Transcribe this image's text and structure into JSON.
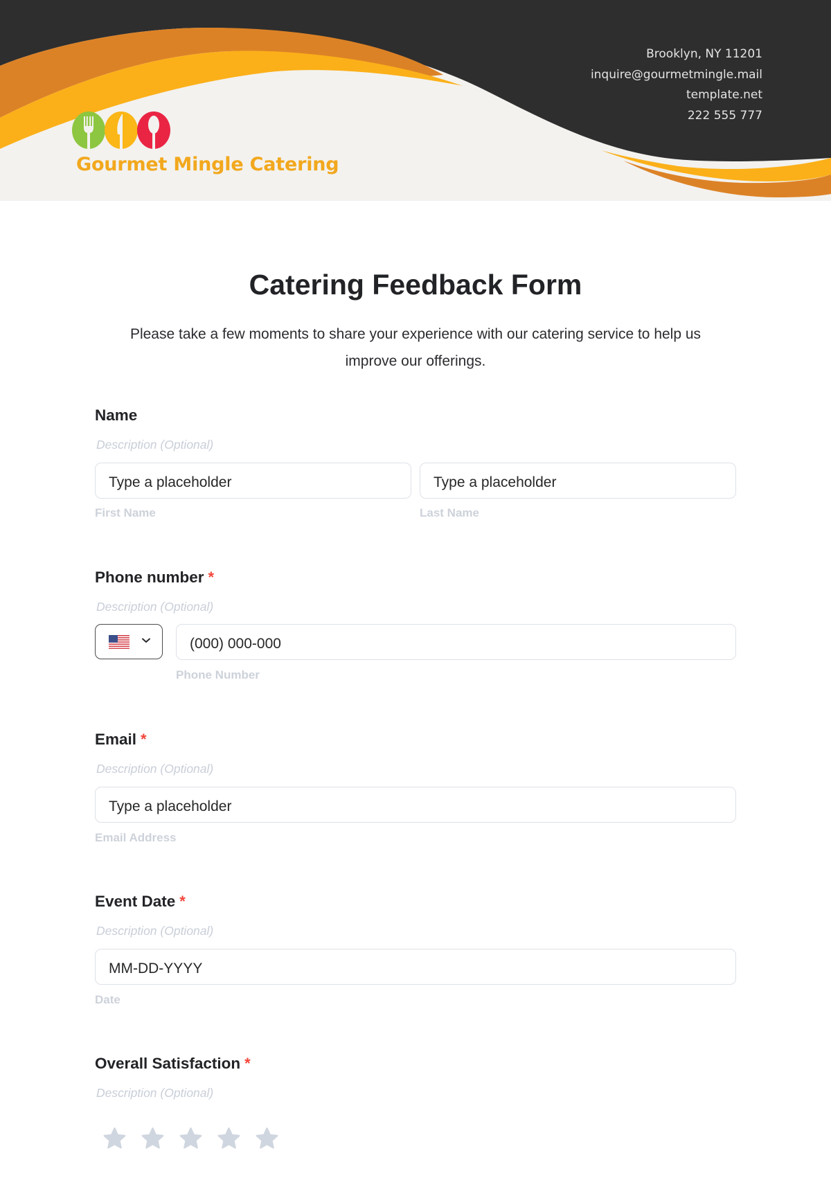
{
  "header": {
    "brand_name": "Gourmet Mingle Catering",
    "logo_icon": "fork-knife-spoon-logo",
    "contact": {
      "address": "Brooklyn, NY 11201",
      "email": "inquire@gourmetmingle.mail",
      "website": "template.net",
      "phone": "222 555 777"
    },
    "colors": {
      "dark": "#2e2e2e",
      "orange": "#dc8226",
      "yellow": "#fbb019",
      "cream": "#f3f2ef",
      "logo_green": "#8dc640",
      "logo_yellow": "#fbb617",
      "logo_red": "#ea2544"
    }
  },
  "form": {
    "title": "Catering Feedback Form",
    "intro_line1": "Please take a few moments to share your experience with our catering service to help us",
    "intro_line2": "improve our offerings.",
    "required_marker": "*",
    "fields": {
      "name": {
        "label": "Name",
        "description": "Description (Optional)",
        "first_placeholder": "Type a placeholder",
        "first_sublabel": "First Name",
        "last_placeholder": "Type a placeholder",
        "last_sublabel": "Last Name"
      },
      "phone": {
        "label": "Phone number",
        "required": true,
        "description": "Description (Optional)",
        "country": "US",
        "country_icon": "us-flag-icon",
        "placeholder": "(000) 000-000",
        "sublabel": "Phone Number"
      },
      "email": {
        "label": "Email",
        "required": true,
        "description": "Description (Optional)",
        "placeholder": "Type a placeholder",
        "sublabel": "Email Address"
      },
      "event_date": {
        "label": "Event Date",
        "required": true,
        "description": "Description (Optional)",
        "placeholder": "MM-DD-YYYY",
        "sublabel": "Date"
      },
      "satisfaction": {
        "label": "Overall Satisfaction",
        "required": true,
        "description": "Description (Optional)",
        "rating": 0,
        "max_rating": 5,
        "star_color": "#d0d6df"
      }
    }
  }
}
